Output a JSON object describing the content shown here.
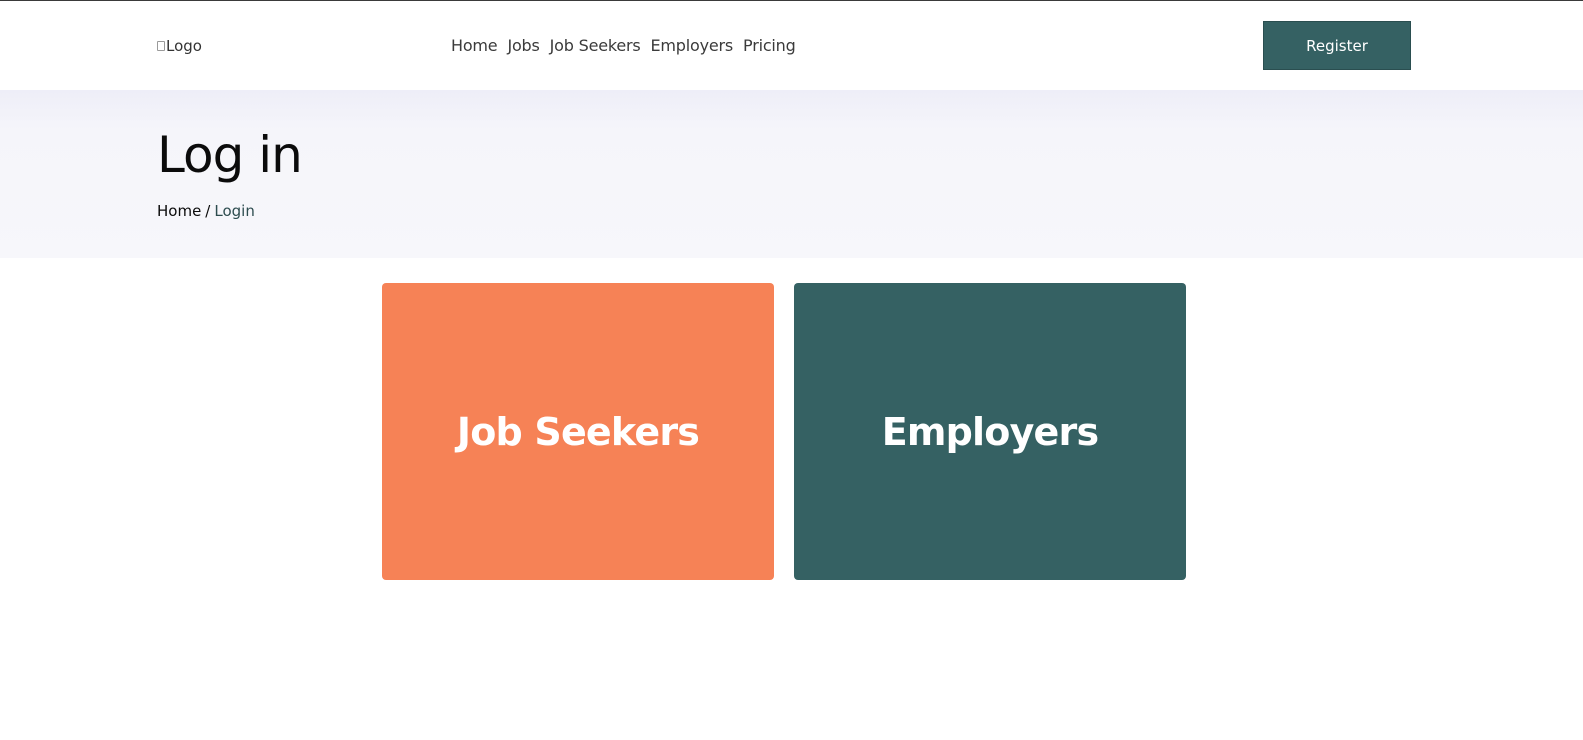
{
  "header": {
    "logo_alt": "Logo",
    "nav": [
      {
        "label": "Home"
      },
      {
        "label": "Jobs"
      },
      {
        "label": "Job Seekers"
      },
      {
        "label": "Employers"
      },
      {
        "label": "Pricing"
      }
    ],
    "register_label": "Register"
  },
  "hero": {
    "title": "Log in",
    "breadcrumb": {
      "home": "Home",
      "separator": "/",
      "current": "Login"
    }
  },
  "cards": [
    {
      "label": "Job Seekers",
      "color": "#f68256"
    },
    {
      "label": "Employers",
      "color": "#356163"
    }
  ],
  "colors": {
    "accent": "#356163",
    "orange": "#f68256",
    "hero_bg": "#f6f6fa"
  },
  "icons": {
    "logo": "broken-image-icon"
  }
}
